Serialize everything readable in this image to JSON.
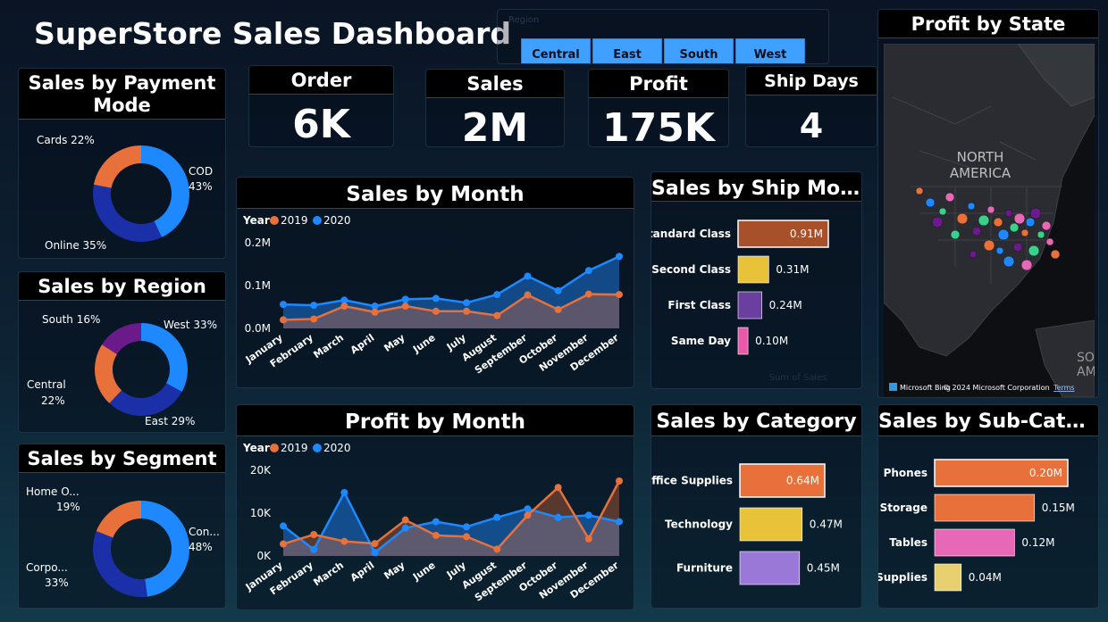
{
  "header": {
    "title": "SuperStore Sales Dashboard"
  },
  "region_slicer": {
    "label": "Region",
    "options": [
      "Central",
      "East",
      "South",
      "West"
    ]
  },
  "kpis": [
    {
      "label": "Order",
      "value": "6K"
    },
    {
      "label": "Sales",
      "value": "2M"
    },
    {
      "label": "Profit",
      "value": "175K"
    },
    {
      "label": "Ship Days",
      "value": "4"
    }
  ],
  "panels": {
    "payment_mode": "Sales by Payment Mode",
    "region": "Sales by Region",
    "segment": "Sales by Segment",
    "sales_month": "Sales by Month",
    "profit_month": "Profit by Month",
    "ship_mode": "Sales by Ship Mo...",
    "category": "Sales by Category",
    "sub_category": "Sales by Sub-Cate...",
    "state": "Profit by State"
  },
  "map": {
    "labels": [
      "NORTH",
      "AMERICA",
      "SO",
      "AME"
    ],
    "attribution": "Microsoft Bing",
    "copyright": "© 2024 Microsoft Corporation",
    "terms": "Terms"
  },
  "colors": {
    "blue": "#1e88ff",
    "orange": "#e8703a",
    "navy": "#1a2fa8",
    "purple": "#6b1a8a"
  },
  "chart_data": [
    {
      "id": "payment_mode",
      "type": "pie",
      "title": "Sales by Payment Mode",
      "labels": [
        "COD",
        "Online",
        "Cards"
      ],
      "values": [
        43,
        35,
        22
      ],
      "display_labels": [
        "COD\n43%",
        "Online 35%",
        "Cards 22%"
      ],
      "colors": [
        "#1e88ff",
        "#1a2fa8",
        "#e8703a"
      ]
    },
    {
      "id": "region",
      "type": "pie",
      "title": "Sales by Region",
      "labels": [
        "West",
        "East",
        "Central",
        "South"
      ],
      "values": [
        33,
        29,
        22,
        16
      ],
      "display_labels": [
        "West 33%",
        "East 29%",
        "Central\n22%",
        "South 16%"
      ],
      "colors": [
        "#1e88ff",
        "#1a2fa8",
        "#e8703a",
        "#6b1a8a"
      ]
    },
    {
      "id": "segment",
      "type": "pie",
      "title": "Sales by Segment",
      "labels": [
        "Consumer",
        "Corporate",
        "Home Office"
      ],
      "values": [
        48,
        33,
        19
      ],
      "display_labels": [
        "Con...\n48%",
        "Corpo...\n33%",
        "Home O...\n19%"
      ],
      "colors": [
        "#1e88ff",
        "#1a2fa8",
        "#e8703a"
      ]
    },
    {
      "id": "sales_month",
      "type": "area",
      "title": "Sales by Month",
      "legend_title": "Year",
      "categories": [
        "January",
        "February",
        "March",
        "April",
        "May",
        "June",
        "July",
        "August",
        "September",
        "October",
        "November",
        "December"
      ],
      "series": [
        {
          "name": "2019",
          "values": [
            0.02,
            0.022,
            0.052,
            0.038,
            0.052,
            0.04,
            0.04,
            0.03,
            0.078,
            0.044,
            0.08,
            0.079
          ]
        },
        {
          "name": "2020",
          "values": [
            0.056,
            0.054,
            0.066,
            0.052,
            0.068,
            0.07,
            0.06,
            0.079,
            0.122,
            0.088,
            0.135,
            0.168
          ]
        }
      ],
      "yticks": [
        "0.0M",
        "0.1M",
        "0.2M"
      ],
      "ylim": [
        0,
        0.2
      ]
    },
    {
      "id": "profit_month",
      "type": "area",
      "title": "Profit by Month",
      "legend_title": "Year",
      "categories": [
        "January",
        "February",
        "March",
        "April",
        "May",
        "June",
        "July",
        "August",
        "September",
        "October",
        "November",
        "December"
      ],
      "series": [
        {
          "name": "2019",
          "values": [
            2800,
            5000,
            3400,
            2900,
            8400,
            4800,
            4500,
            1600,
            9500,
            16000,
            4000,
            17500
          ]
        },
        {
          "name": "2020",
          "values": [
            7000,
            1500,
            14800,
            800,
            6500,
            8000,
            6800,
            9000,
            11000,
            9000,
            9500,
            8000
          ]
        }
      ],
      "yticks": [
        "0K",
        "10K",
        "20K"
      ],
      "ylim": [
        0,
        20000
      ]
    },
    {
      "id": "ship_mode",
      "type": "bar",
      "title": "Sales by Ship Mode",
      "categories": [
        "Standard Class",
        "Second Class",
        "First Class",
        "Same Day"
      ],
      "values": [
        0.91,
        0.31,
        0.24,
        0.1
      ],
      "value_labels": [
        "0.91M",
        "0.31M",
        "0.24M",
        "0.10M"
      ],
      "colors": [
        "#a8502a",
        "#e8c33a",
        "#6b3fa0",
        "#e85aa8"
      ],
      "xlabel": "Sum of Sales"
    },
    {
      "id": "category",
      "type": "bar",
      "title": "Sales by Category",
      "categories": [
        "Office Supplies",
        "Technology",
        "Furniture"
      ],
      "values": [
        0.64,
        0.47,
        0.45
      ],
      "value_labels": [
        "0.64M",
        "0.47M",
        "0.45M"
      ],
      "colors": [
        "#e8703a",
        "#e8c33a",
        "#9a78d8"
      ]
    },
    {
      "id": "sub_category",
      "type": "bar",
      "title": "Sales by Sub-Category",
      "categories": [
        "Phones",
        "Storage",
        "Tables",
        "Supplies"
      ],
      "values": [
        0.2,
        0.15,
        0.12,
        0.04
      ],
      "value_labels": [
        "0.20M",
        "0.15M",
        "0.12M",
        "0.04M"
      ],
      "colors": [
        "#e8703a",
        "#e8703a",
        "#e868b8",
        "#e8d070"
      ]
    }
  ]
}
